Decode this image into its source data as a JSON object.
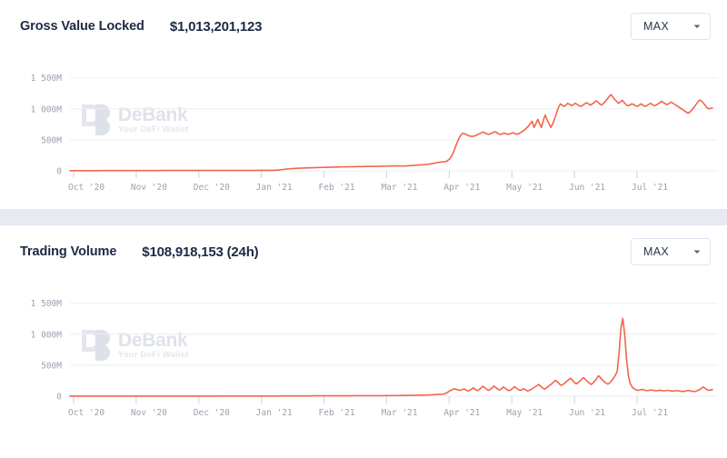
{
  "panels": [
    {
      "title": "Gross Value Locked",
      "value": "$1,013,201,123",
      "range_label": "MAX",
      "chevron_icon": "chevron-down-icon",
      "watermark": {
        "name": "DeBank",
        "tagline": "Your DeFi Wallet",
        "logo_icon": "debank-logo-icon"
      }
    },
    {
      "title": "Trading Volume",
      "value": "$108,918,153 (24h)",
      "range_label": "MAX",
      "chevron_icon": "chevron-down-icon",
      "watermark": {
        "name": "DeBank",
        "tagline": "Your DeFi Wallet",
        "logo_icon": "debank-logo-icon"
      }
    }
  ],
  "colors": {
    "series": "#f2664a",
    "title": "#1d2a45",
    "grid": "#eceef2",
    "axis_text": "#9aa1ae",
    "divider": "#e7e9f3",
    "border": "#dfe3ec"
  },
  "chart_data": [
    {
      "type": "line",
      "title": "Gross Value Locked",
      "xlabel": "",
      "ylabel": "",
      "ylim": [
        0,
        1700
      ],
      "yticks": [
        0,
        500,
        1000,
        1500
      ],
      "ytick_labels": [
        "0",
        "500M",
        "1 000M",
        "1 500M"
      ],
      "grid": true,
      "legend": "none",
      "unit": "USD millions",
      "xticks": [
        "Oct '20",
        "Nov '20",
        "Dec '20",
        "Jan '21",
        "Feb '21",
        "Mar '21",
        "Apr '21",
        "May '21",
        "Jun '21",
        "Jul '21"
      ],
      "x_range": [
        "Oct '20",
        "Aug '21"
      ],
      "series": [
        {
          "name": "Gross Value Locked",
          "color": "#f2664a",
          "values": [
            2,
            2,
            2,
            2,
            2,
            3,
            3,
            3,
            3,
            3,
            3,
            3,
            3,
            3,
            3,
            3,
            3,
            4,
            4,
            4,
            4,
            4,
            4,
            4,
            4,
            4,
            5,
            5,
            5,
            5,
            5,
            5,
            5,
            5,
            5,
            5,
            5,
            5,
            5,
            5,
            5,
            5,
            5,
            5,
            5,
            5,
            5,
            5,
            5,
            6,
            6,
            6,
            6,
            6,
            6,
            6,
            6,
            6,
            6,
            6,
            6,
            6,
            6,
            6,
            6,
            6,
            6,
            6,
            6,
            6,
            6,
            6,
            6,
            6,
            6,
            6,
            6,
            7,
            7,
            7,
            7,
            7,
            7,
            7,
            7,
            7,
            7,
            7,
            7,
            7,
            7,
            7,
            7,
            7,
            7,
            7,
            7,
            7,
            7,
            7,
            8,
            8,
            8,
            8,
            8,
            8,
            8,
            8,
            9,
            10,
            12,
            14,
            17,
            20,
            24,
            28,
            31,
            33,
            35,
            37,
            39,
            41,
            43,
            44,
            45,
            46,
            47,
            48,
            49,
            50,
            51,
            52,
            53,
            54,
            55,
            56,
            57,
            58,
            58,
            59,
            60,
            61,
            62,
            62,
            63,
            64,
            64,
            65,
            65,
            66,
            66,
            67,
            67,
            68,
            68,
            69,
            69,
            70,
            70,
            71,
            71,
            72,
            72,
            73,
            73,
            74,
            74,
            75,
            75,
            76,
            77,
            78,
            79,
            80,
            80,
            79,
            78,
            77,
            78,
            80,
            82,
            84,
            86,
            88,
            90,
            92,
            94,
            96,
            98,
            101,
            104,
            108,
            112,
            118,
            124,
            130,
            136,
            140,
            143,
            146,
            150,
            165,
            190,
            230,
            290,
            370,
            450,
            520,
            575,
            605,
            600,
            585,
            570,
            560,
            555,
            560,
            570,
            585,
            600,
            615,
            625,
            610,
            595,
            590,
            600,
            615,
            630,
            620,
            600,
            585,
            595,
            610,
            600,
            590,
            595,
            605,
            615,
            600,
            590,
            600,
            620,
            640,
            660,
            690,
            720,
            760,
            800,
            700,
            760,
            830,
            760,
            700,
            820,
            900,
            820,
            760,
            700,
            760,
            840,
            930,
            1020,
            1080,
            1060,
            1040,
            1060,
            1090,
            1070,
            1050,
            1070,
            1090,
            1070,
            1050,
            1040,
            1060,
            1080,
            1100,
            1080,
            1060,
            1080,
            1100,
            1130,
            1110,
            1080,
            1060,
            1090,
            1120,
            1160,
            1200,
            1230,
            1190,
            1150,
            1120,
            1090,
            1110,
            1140,
            1100,
            1070,
            1050,
            1060,
            1080,
            1070,
            1050,
            1040,
            1060,
            1080,
            1060,
            1040,
            1050,
            1070,
            1090,
            1070,
            1050,
            1060,
            1080,
            1100,
            1120,
            1100,
            1080,
            1070,
            1090,
            1110,
            1090,
            1070,
            1050,
            1030,
            1010,
            990,
            970,
            950,
            930,
            950,
            980,
            1020,
            1060,
            1100,
            1140,
            1130,
            1100,
            1060,
            1020,
            1000,
            1010,
            1013
          ]
        }
      ]
    },
    {
      "type": "line",
      "title": "Trading Volume",
      "xlabel": "",
      "ylabel": "",
      "ylim": [
        0,
        1700
      ],
      "yticks": [
        0,
        500,
        1000,
        1500
      ],
      "ytick_labels": [
        "0",
        "500M",
        "1 000M",
        "1 500M"
      ],
      "grid": true,
      "legend": "none",
      "unit": "USD millions",
      "xticks": [
        "Oct '20",
        "Nov '20",
        "Dec '20",
        "Jan '21",
        "Feb '21",
        "Mar '21",
        "Apr '21",
        "May '21",
        "Jun '21",
        "Jul '21"
      ],
      "x_range": [
        "Oct '20",
        "Aug '21"
      ],
      "series": [
        {
          "name": "Trading Volume (24h)",
          "color": "#f2664a",
          "values": [
            1,
            1,
            1,
            1,
            1,
            1,
            1,
            1,
            1,
            1,
            1,
            1,
            1,
            1,
            1,
            1,
            1,
            1,
            1,
            1,
            1,
            1,
            1,
            1,
            1,
            1,
            1,
            1,
            1,
            1,
            1,
            1,
            1,
            1,
            1,
            1,
            1,
            1,
            1,
            1,
            1,
            1,
            1,
            1,
            1,
            1,
            1,
            1,
            1,
            1,
            1,
            1,
            1,
            1,
            1,
            1,
            1,
            1,
            1,
            1,
            1,
            1,
            1,
            1,
            1,
            1,
            1,
            1,
            1,
            1,
            1,
            1,
            1,
            1,
            1,
            1,
            1,
            1,
            1,
            1,
            2,
            2,
            2,
            2,
            2,
            2,
            2,
            2,
            2,
            2,
            2,
            2,
            2,
            2,
            2,
            2,
            2,
            2,
            2,
            2,
            2,
            2,
            2,
            2,
            2,
            2,
            2,
            2,
            3,
            3,
            3,
            3,
            3,
            4,
            4,
            4,
            4,
            4,
            4,
            4,
            5,
            5,
            5,
            5,
            5,
            5,
            5,
            5,
            5,
            5,
            6,
            6,
            6,
            6,
            6,
            6,
            6,
            6,
            6,
            6,
            6,
            6,
            7,
            7,
            7,
            7,
            7,
            7,
            7,
            7,
            7,
            7,
            8,
            8,
            8,
            8,
            8,
            8,
            8,
            8,
            8,
            8,
            8,
            9,
            9,
            9,
            9,
            9,
            9,
            10,
            10,
            10,
            10,
            10,
            11,
            11,
            11,
            12,
            12,
            12,
            13,
            13,
            14,
            14,
            15,
            15,
            16,
            16,
            17,
            18,
            19,
            20,
            21,
            22,
            23,
            24,
            26,
            28,
            30,
            32,
            35,
            45,
            60,
            80,
            95,
            110,
            120,
            110,
            100,
            95,
            105,
            120,
            100,
            85,
            95,
            115,
            135,
            110,
            90,
            105,
            130,
            160,
            140,
            115,
            95,
            110,
            135,
            165,
            140,
            115,
            100,
            120,
            150,
            130,
            105,
            90,
            100,
            125,
            155,
            130,
            110,
            95,
            105,
            120,
            100,
            85,
            95,
            110,
            130,
            150,
            170,
            190,
            160,
            135,
            115,
            130,
            155,
            180,
            200,
            230,
            255,
            230,
            200,
            175,
            190,
            215,
            240,
            265,
            290,
            260,
            225,
            200,
            215,
            245,
            275,
            300,
            270,
            240,
            215,
            190,
            210,
            245,
            285,
            330,
            300,
            265,
            235,
            210,
            195,
            215,
            250,
            290,
            340,
            400,
            700,
            1100,
            1255,
            1000,
            600,
            330,
            200,
            150,
            120,
            105,
            95,
            100,
            110,
            105,
            95,
            90,
            95,
            100,
            95,
            90,
            88,
            92,
            96,
            90,
            86,
            90,
            95,
            90,
            85,
            82,
            86,
            90,
            85,
            80,
            76,
            80,
            86,
            92,
            86,
            80,
            76,
            80,
            90,
            105,
            125,
            150,
            130,
            105,
            95,
            100,
            109
          ]
        }
      ]
    }
  ]
}
